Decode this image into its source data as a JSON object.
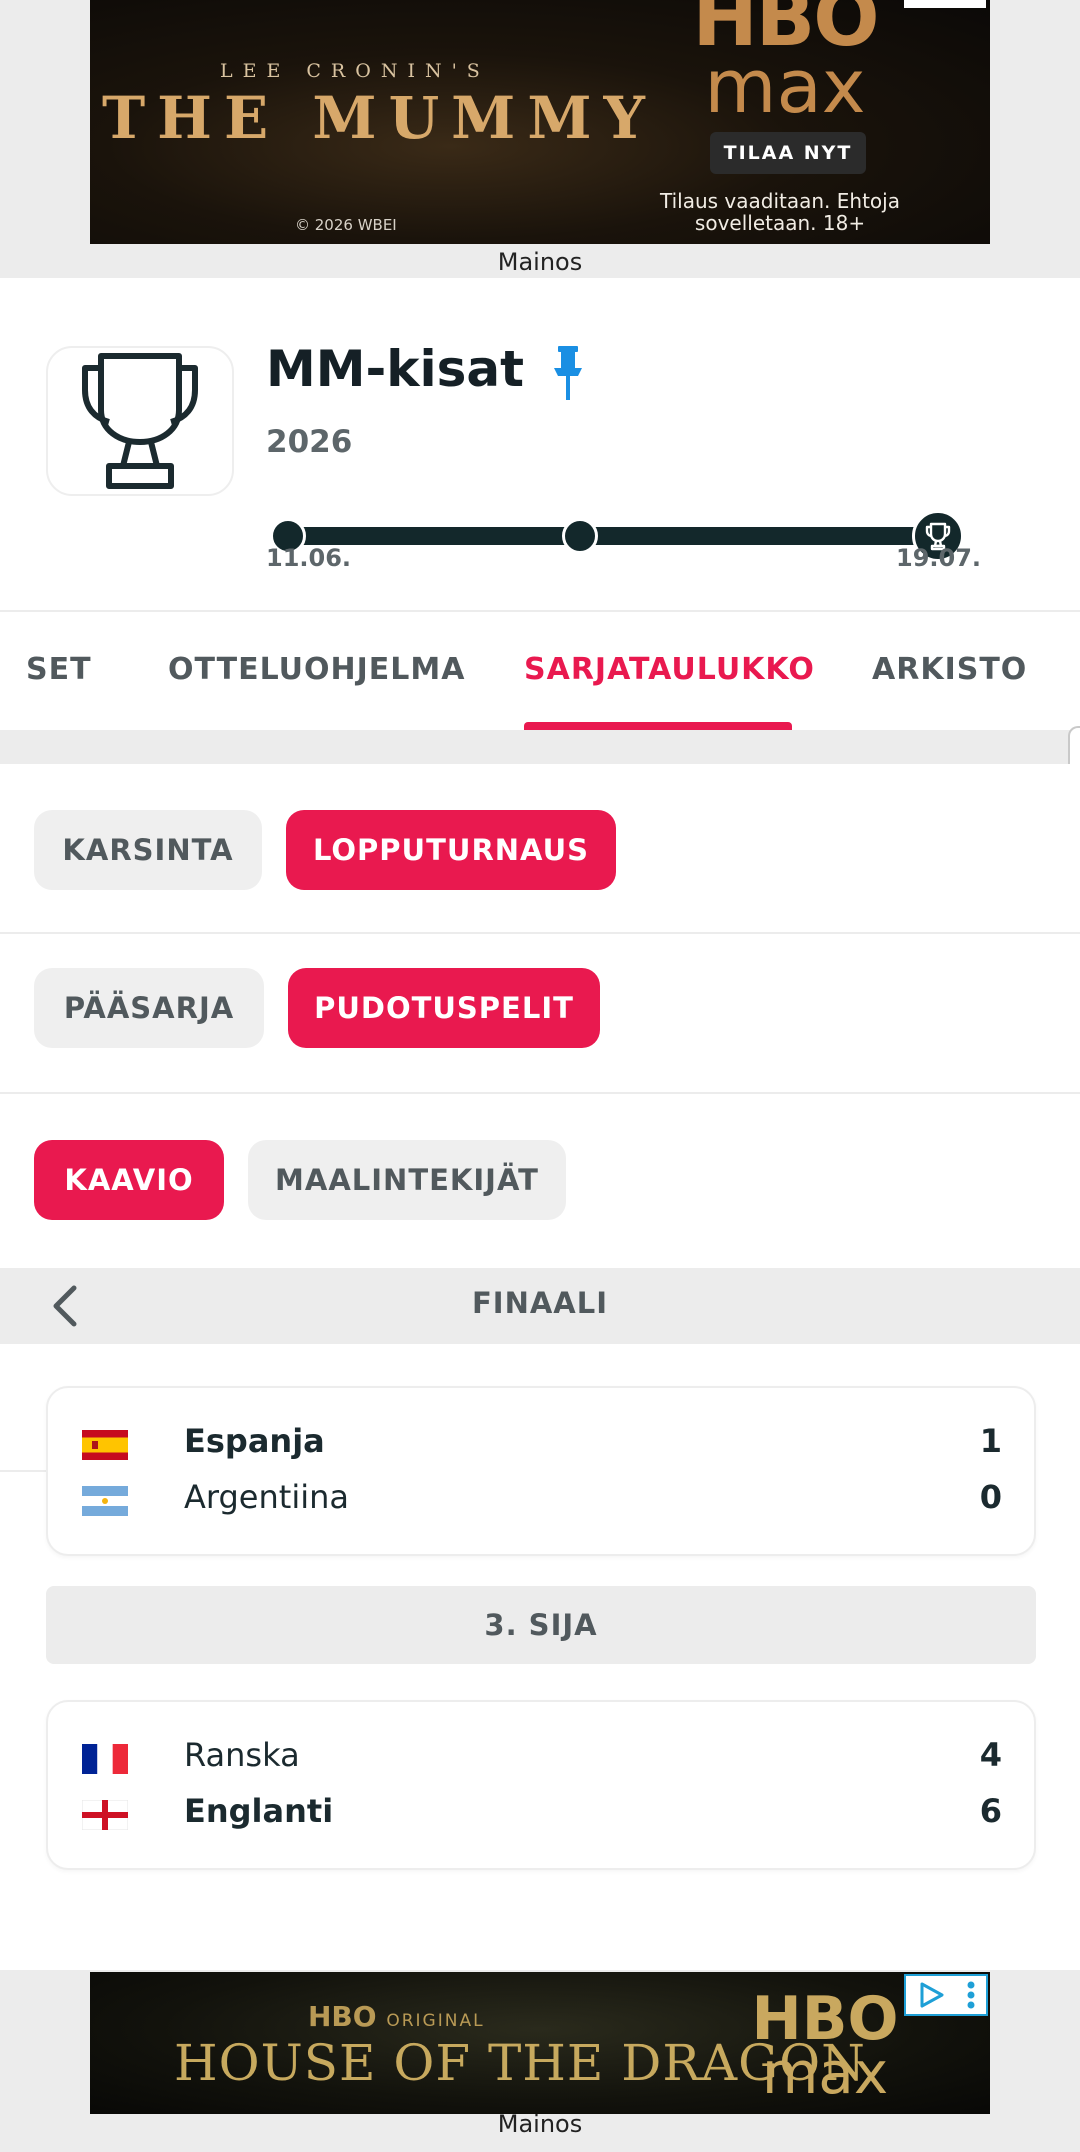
{
  "ad_top": {
    "kicker": "LEE CRONIN'S",
    "movie": "THE MUMMY",
    "copyright": "© 2026 WBEI",
    "brand_line1": "HBO",
    "brand_line2": "max",
    "cta": "TILAA NYT",
    "terms": "Tilaus vaaditaan. Ehtoja sovelletaan. 18+",
    "label": "Mainos"
  },
  "header": {
    "title": "MM-kisat",
    "season": "2026",
    "date_start": "11.06.",
    "date_end": "19.07.",
    "info_glyph": "i",
    "logo_icon": "trophy-icon",
    "pin_icon": "pin-icon",
    "pin_color": "#1a8fe3"
  },
  "tabs": [
    {
      "label": "SET",
      "active": false
    },
    {
      "label": "OTTELUOHJELMA",
      "active": false
    },
    {
      "label": "SARJATAULUKKO",
      "active": true
    },
    {
      "label": "ARKISTO",
      "active": false
    }
  ],
  "filters": {
    "phase": [
      {
        "label": "KARSINTA",
        "active": false
      },
      {
        "label": "LOPPUTURNAUS",
        "active": true
      }
    ],
    "stage": [
      {
        "label": "PÄÄSARJA",
        "active": false
      },
      {
        "label": "PUDOTUSPELIT",
        "active": true
      }
    ],
    "view": [
      {
        "label": "KAAVIO",
        "active": true
      },
      {
        "label": "MAALINTEKIJÄT",
        "active": false
      }
    ]
  },
  "round": {
    "name": "FINAALI",
    "back_icon": "chevron-left-icon"
  },
  "final_match": {
    "home": {
      "name": "Espanja",
      "score": "1",
      "flag": "spain-flag-icon",
      "winner": true
    },
    "away": {
      "name": "Argentiina",
      "score": "0",
      "flag": "argentina-flag-icon",
      "winner": false
    }
  },
  "third_place": {
    "label": "3. SIJA",
    "home": {
      "name": "Ranska",
      "score": "4",
      "flag": "france-flag-icon",
      "winner": false
    },
    "away": {
      "name": "Englanti",
      "score": "6",
      "flag": "england-flag-icon",
      "winner": true
    }
  },
  "ad_bottom": {
    "hbo": "HBO",
    "hbo_original": "ORIGINAL",
    "show": "HOUSE OF THE DRAGON",
    "brand_line1": "HBO",
    "brand_line2": "max",
    "label": "Mainos"
  },
  "colors": {
    "accent": "#e9194f",
    "dark": "#13282b",
    "muted": "#51595d"
  }
}
